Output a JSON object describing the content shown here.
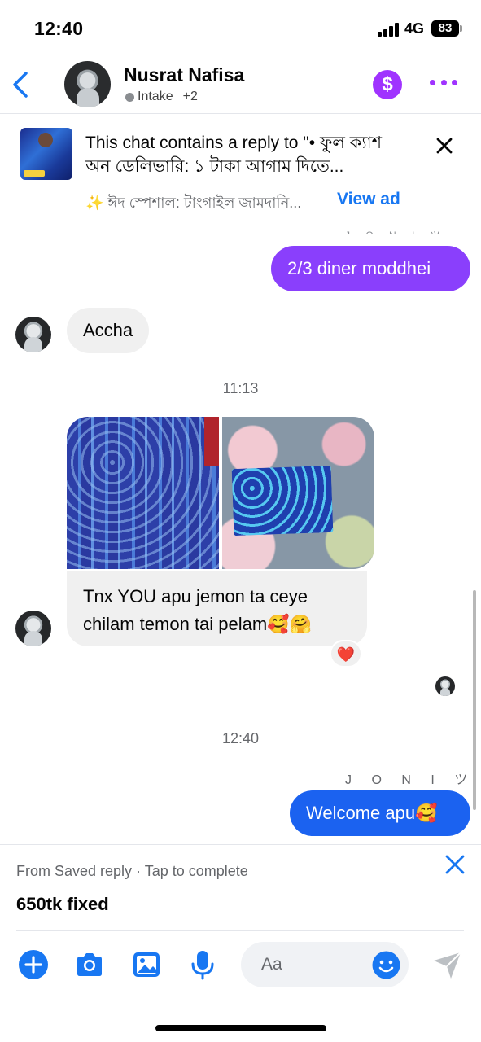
{
  "status_bar": {
    "time": "12:40",
    "network": "4G",
    "battery": "83"
  },
  "header": {
    "contact_name": "Nusrat Nafisa",
    "label": "Intake",
    "extra": "+2",
    "dollar_symbol": "$"
  },
  "ad": {
    "text": "This chat contains a reply to \"• ফুল ক্যাশ অন ডেলিভারি: ১ টাকা আগাম দিতে...",
    "subtitle": "✨ ঈদ স্পেশাল: টাংগাইল জামদানি...",
    "view_ad": "View ad"
  },
  "messages": {
    "outgoing_1": "2/3 diner moddhei",
    "incoming_1": "Accha",
    "time_1": "11:13",
    "incoming_2_line1": "Tnx YOU  apu jemon ta ceye",
    "incoming_2_line2": "chilam temon tai  pelam🥰🤗",
    "reaction": "❤️",
    "time_2": "12:40",
    "sender_name": "J O N I ツ",
    "outgoing_2": "Welcome apu🥰"
  },
  "saved_reply": {
    "hint": "From Saved reply · Tap to complete",
    "text": "650tk fixed"
  },
  "composer": {
    "placeholder": "Aa"
  },
  "colors": {
    "messenger_purple": "#8a3ffc",
    "messenger_blue": "#1b62f0",
    "accent_blue": "#1877f2"
  }
}
